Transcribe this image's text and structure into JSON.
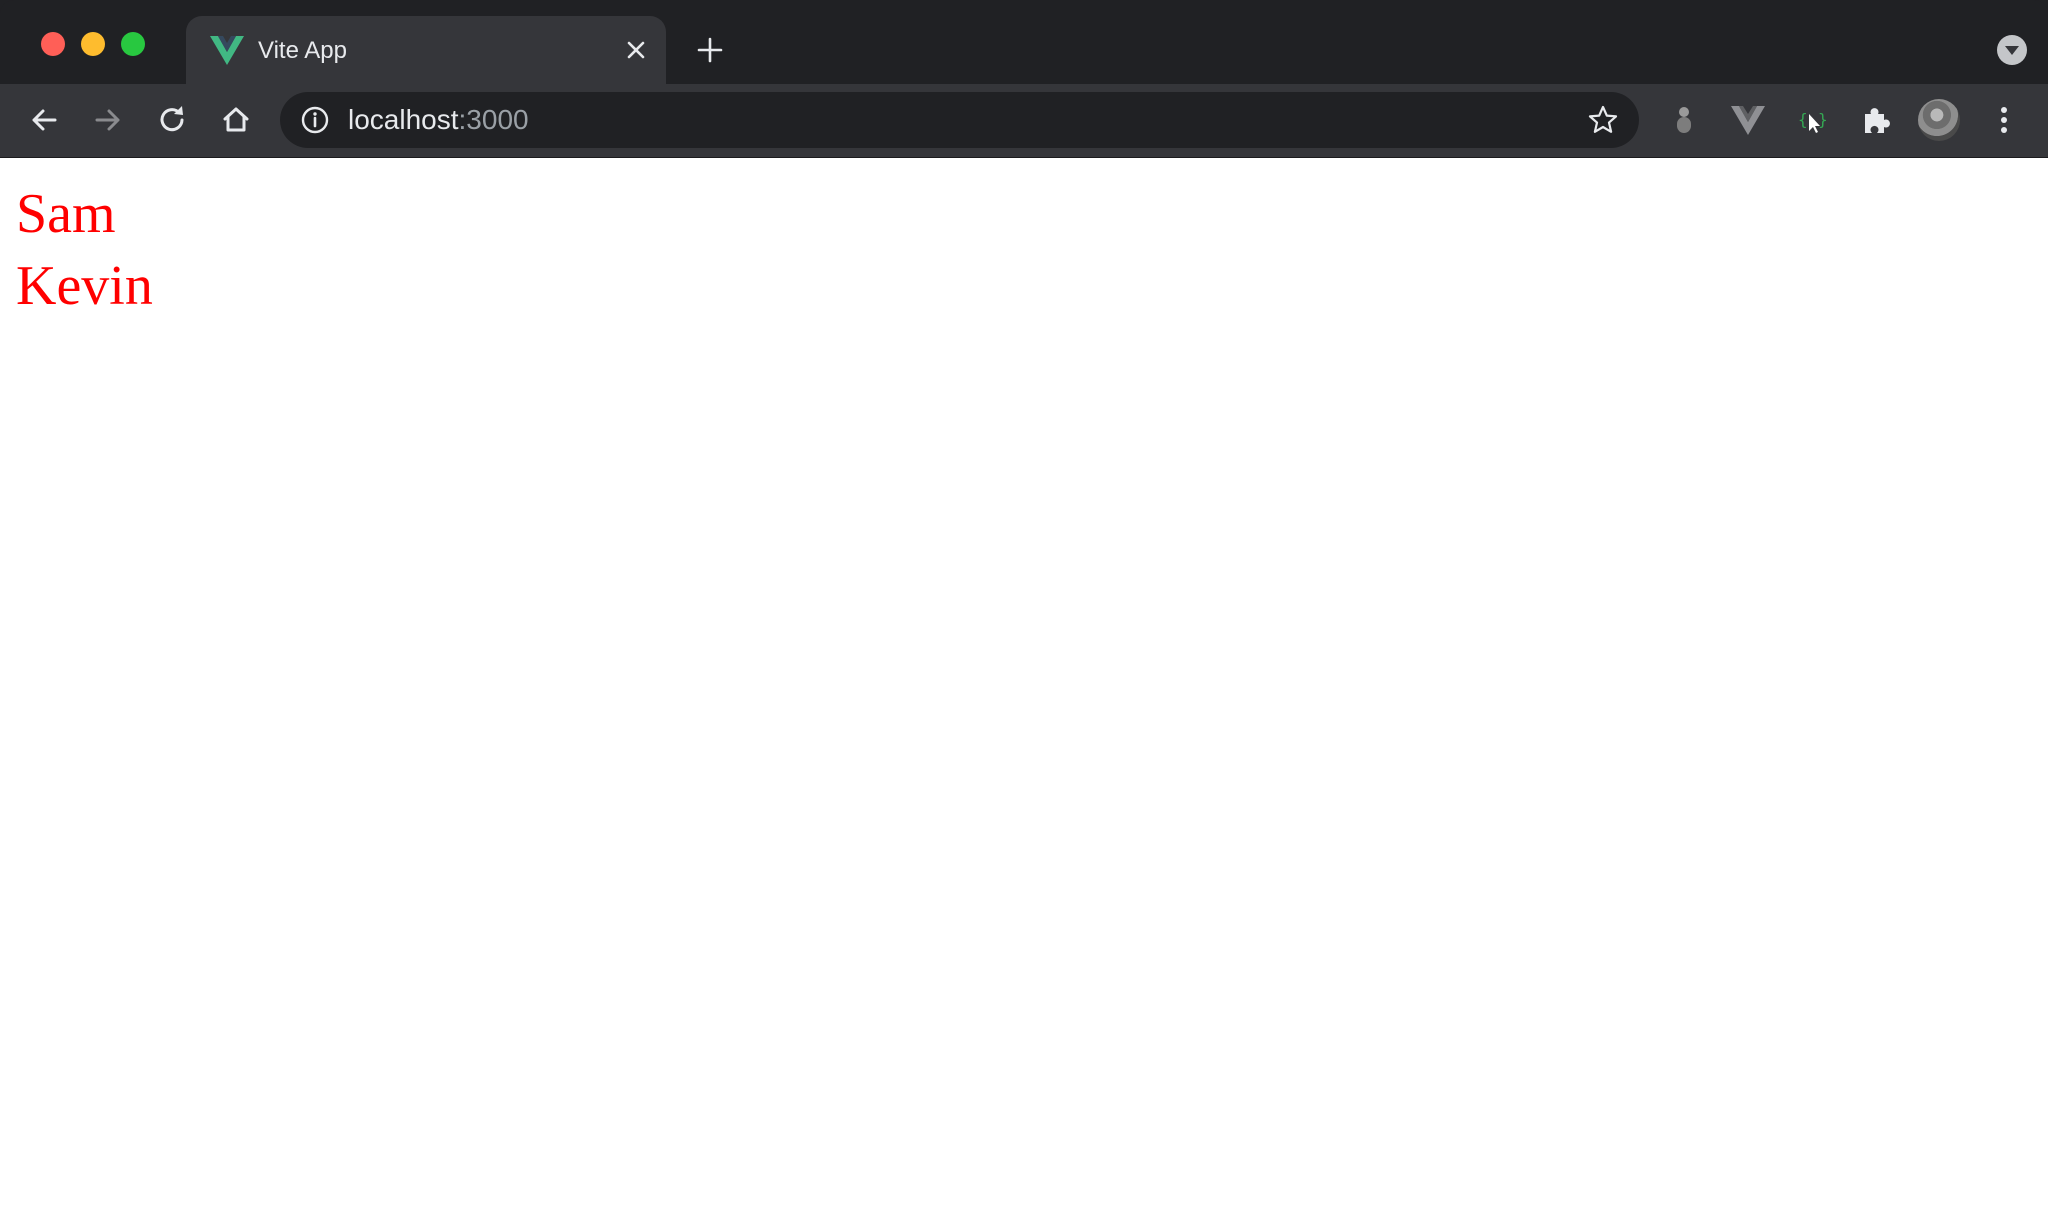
{
  "browser": {
    "tab": {
      "title": "Vite App",
      "favicon": "vue-logo-icon"
    },
    "address": {
      "host": "localhost",
      "port": ":3000"
    },
    "extensions": [
      "extension-grey-icon",
      "vue-devtools-icon",
      "selector-extension-icon",
      "puzzle-extensions-icon"
    ],
    "colors": {
      "frame": "#202124",
      "toolbar": "#35363a",
      "omnibox": "#202124"
    }
  },
  "content": {
    "names": [
      "Sam",
      "Kevin"
    ],
    "text_color": "#ff0000"
  }
}
